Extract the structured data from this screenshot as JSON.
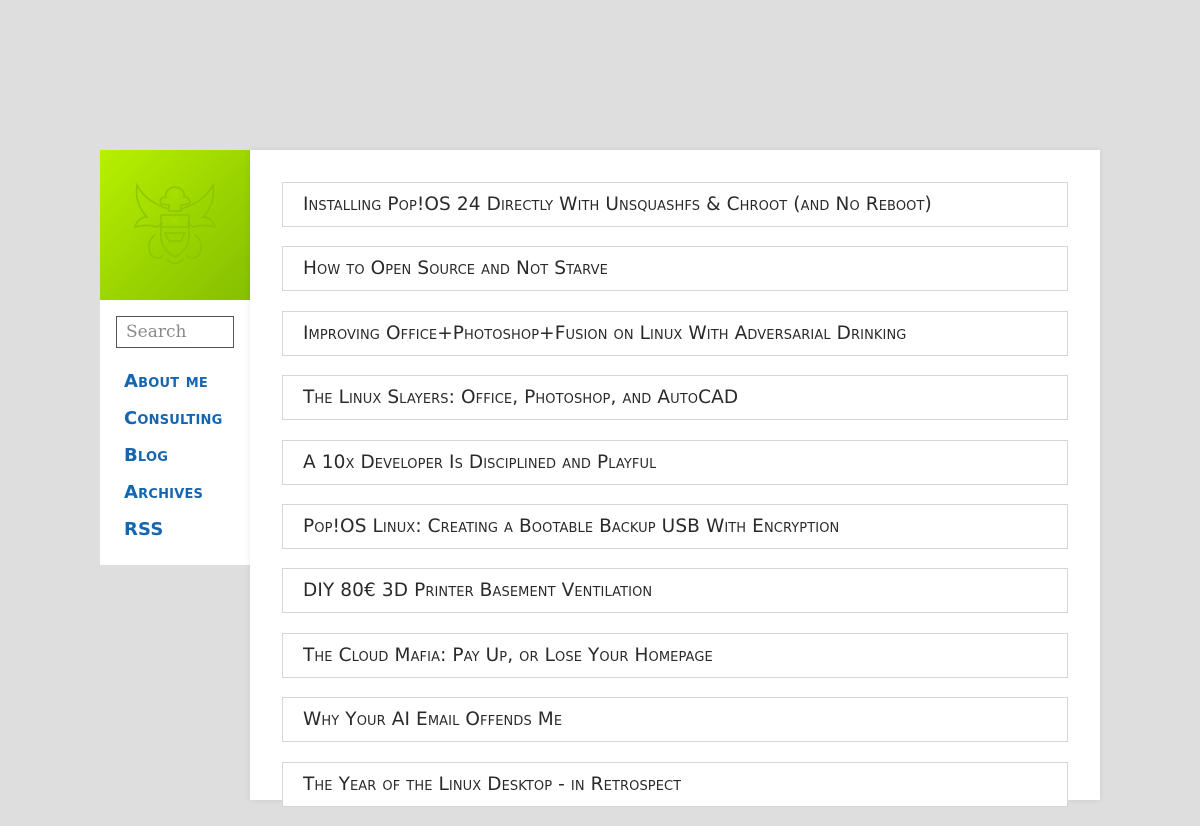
{
  "sidebar": {
    "logo_icon": "eagle-crest-emblem",
    "logo_color": "#9ad400",
    "search": {
      "placeholder": "Search",
      "value": ""
    },
    "nav": [
      {
        "label": "About me"
      },
      {
        "label": "Consulting"
      },
      {
        "label": "Blog"
      },
      {
        "label": "Archives"
      },
      {
        "label": "RSS"
      }
    ],
    "link_color": "#1466b0"
  },
  "posts": [
    {
      "title": "Installing Pop!OS 24 Directly With Unsquashfs & Chroot (and No Reboot)"
    },
    {
      "title": "How to Open Source and Not Starve"
    },
    {
      "title": "Improving Office+Photoshop+Fusion on Linux With Adversarial Drinking"
    },
    {
      "title": "The Linux Slayers: Office, Photoshop, and AutoCAD"
    },
    {
      "title": "A 10x Developer Is Disciplined and Playful"
    },
    {
      "title": "Pop!OS Linux: Creating a Bootable Backup USB With Encryption"
    },
    {
      "title": "DIY 80€ 3D Printer Basement Ventilation"
    },
    {
      "title": "The Cloud Mafia: Pay Up, or Lose Your Homepage"
    },
    {
      "title": "Why Your AI Email Offends Me"
    },
    {
      "title": "The Year of the Linux Desktop - in Retrospect"
    }
  ]
}
